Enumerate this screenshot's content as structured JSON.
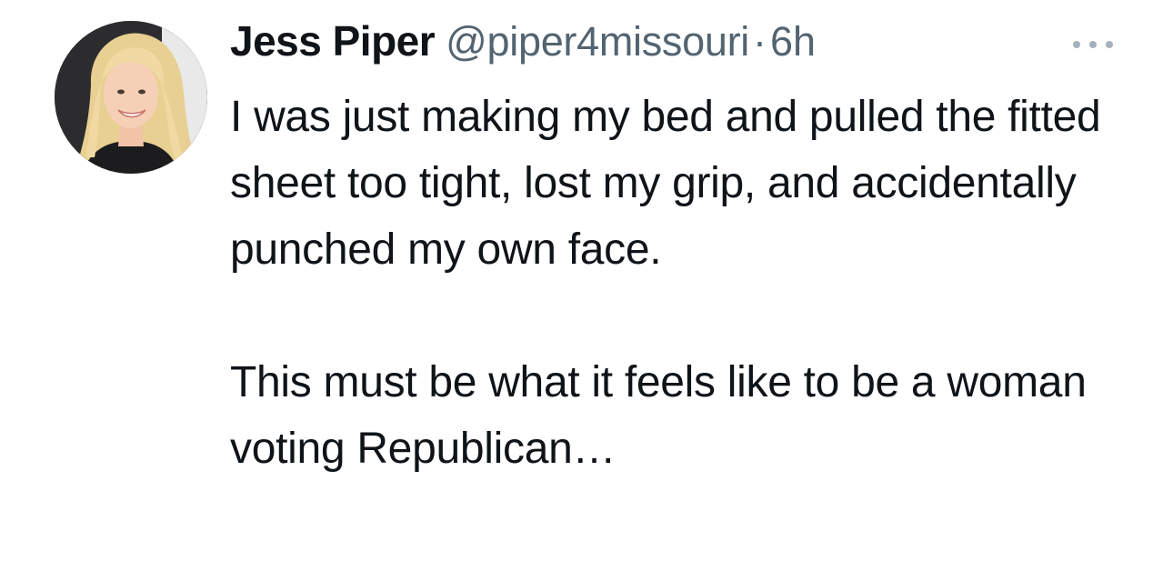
{
  "tweet": {
    "author": {
      "name": "Jess Piper",
      "handle": "@piper4missouri",
      "separator": "·",
      "time": "6h",
      "avatar_icon": "profile-photo-avatar"
    },
    "more_icon": "more-options-icon",
    "paragraphs": [
      "I was just making my bed and pulled the fitted sheet too tight, lost my grip, and accidentally punched my own face.",
      "This must be what it feels like to be a woman voting Republican…"
    ]
  },
  "colors": {
    "text_primary": "#0f1419",
    "text_secondary": "#536471",
    "background": "#ffffff"
  }
}
